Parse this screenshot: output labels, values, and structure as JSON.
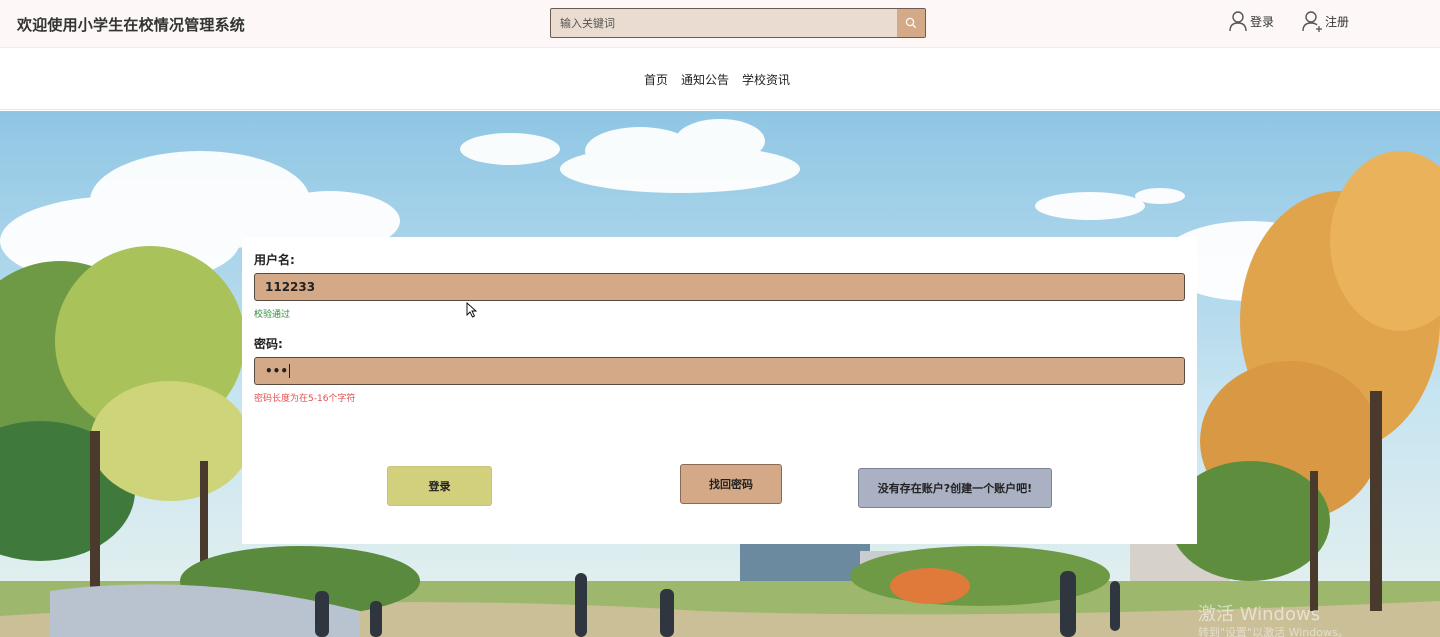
{
  "header": {
    "site_title": "欢迎使用小学生在校情况管理系统",
    "search_placeholder": "输入关键词",
    "login_label": "登录",
    "register_label": "注册"
  },
  "nav": {
    "items": [
      "首页",
      "通知公告",
      "学校资讯"
    ]
  },
  "form": {
    "username_label": "用户名:",
    "username_value": "112233",
    "username_hint": "校验通过",
    "password_label": "密码:",
    "password_value": "•••",
    "password_hint": "密码长度为在5-16个字符",
    "login_button": "登录",
    "reset_button": "找回密码",
    "register_button": "没有存在账户?创建一个账户吧!"
  },
  "watermark": {
    "line1": "激活 Windows",
    "line2": "转到\"设置\"以激活 Windows。"
  },
  "colors": {
    "input_bg": "#d4a987",
    "login_btn": "#d3d07d",
    "register_btn": "#a9b1c3",
    "ok_hint": "#2e8b3a",
    "err_hint": "#e05050"
  }
}
